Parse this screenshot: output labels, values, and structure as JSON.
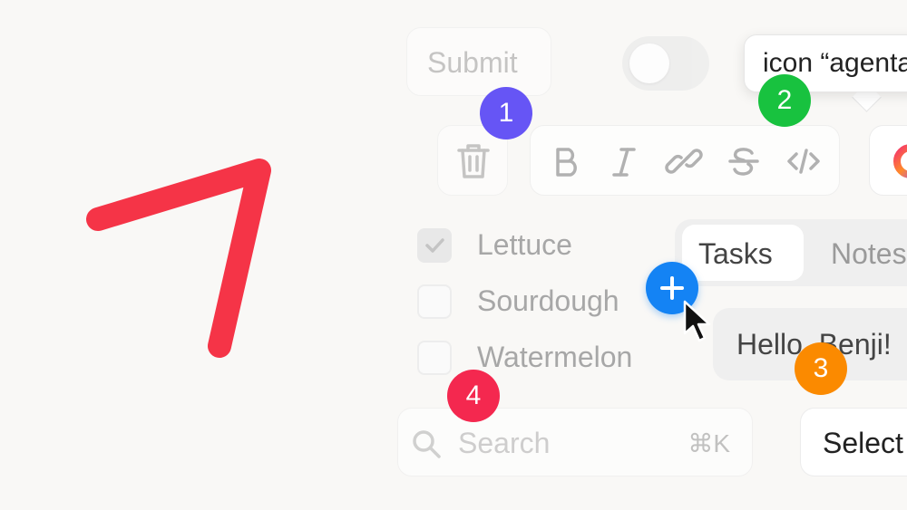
{
  "logo": {
    "color": "#f53447",
    "icon": "checkmark-stroke-logo"
  },
  "submit_button": {
    "label": "Submit"
  },
  "toggle": {
    "state": "off"
  },
  "tooltip": {
    "text": "icon “agenta"
  },
  "toolbar": {
    "trash_icon": "trash-icon",
    "format_icons": [
      "bold-icon",
      "italic-icon",
      "link-icon",
      "strikethrough-icon",
      "code-icon"
    ],
    "app_icon": "gradient-ring-app-icon"
  },
  "checklist": {
    "items": [
      {
        "label": "Lettuce",
        "checked": true
      },
      {
        "label": "Sourdough",
        "checked": false
      },
      {
        "label": "Watermelon",
        "checked": false
      }
    ]
  },
  "tabs": {
    "items": [
      "Tasks",
      "Notes"
    ],
    "active": "Tasks"
  },
  "add_button": {
    "icon": "plus-icon",
    "color": "#1483f4"
  },
  "greeting": {
    "text": "Hello, Benji!"
  },
  "search": {
    "placeholder": "Search",
    "shortcut": "⌘K"
  },
  "select": {
    "value": "Select"
  },
  "badges": [
    {
      "number": "1",
      "color": "#6655f5"
    },
    {
      "number": "2",
      "color": "#18c23f"
    },
    {
      "number": "3",
      "color": "#fb8a00"
    },
    {
      "number": "4",
      "color": "#f4284f"
    }
  ]
}
